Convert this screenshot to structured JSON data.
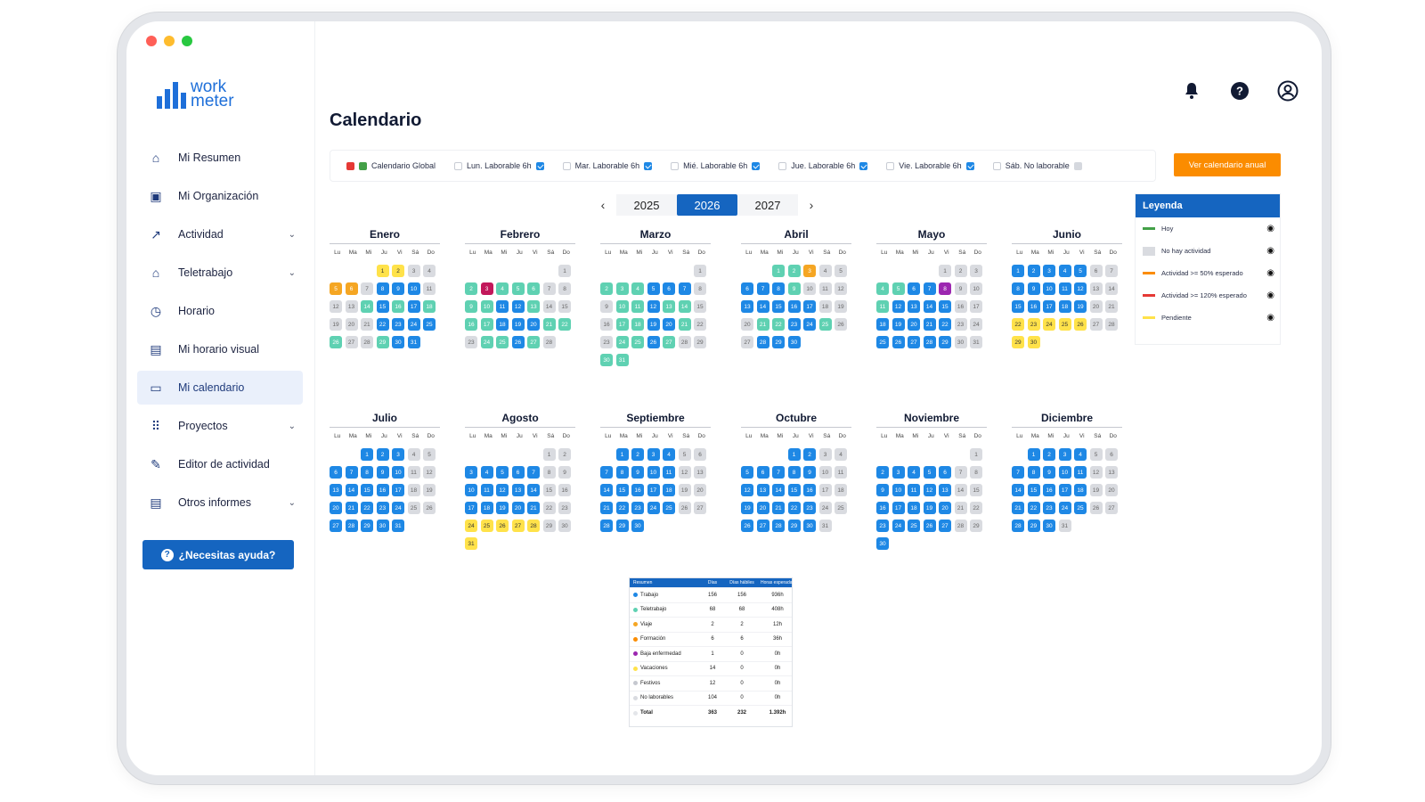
{
  "window": {
    "dot_colors": [
      "#ff5f57",
      "#febc2e",
      "#28c840"
    ]
  },
  "brand": {
    "line1": "work",
    "line2": "meter"
  },
  "sidebar": {
    "items": [
      {
        "label": "Mi Resumen",
        "icon": "home-icon",
        "chevron": false,
        "active": false
      },
      {
        "label": "Mi Organización",
        "icon": "calendar-org-icon",
        "chevron": false,
        "active": false
      },
      {
        "label": "Actividad",
        "icon": "trend-icon",
        "chevron": true,
        "active": false
      },
      {
        "label": "Teletrabajo",
        "icon": "house-work-icon",
        "chevron": true,
        "active": false
      },
      {
        "label": "Horario",
        "icon": "clock-icon",
        "chevron": false,
        "active": false
      },
      {
        "label": "Mi horario visual",
        "icon": "visual-schedule-icon",
        "chevron": false,
        "active": false
      },
      {
        "label": "Mi calendario",
        "icon": "calendar-icon",
        "chevron": false,
        "active": true
      },
      {
        "label": "Proyectos",
        "icon": "grid-icon",
        "chevron": true,
        "active": false
      },
      {
        "label": "Editor de actividad",
        "icon": "pencil-icon",
        "chevron": false,
        "active": false
      },
      {
        "label": "Otros informes",
        "icon": "document-icon",
        "chevron": true,
        "active": false
      }
    ],
    "help_label": "¿Necesitas ayuda?"
  },
  "header": {
    "title": "Calendario"
  },
  "filters": [
    {
      "label": "Calendario Global",
      "state": "global"
    },
    {
      "label": "Lun. Laborable 6h",
      "state": "on"
    },
    {
      "label": "Mar. Laborable 6h",
      "state": "on"
    },
    {
      "label": "Mié. Laborable 6h",
      "state": "on"
    },
    {
      "label": "Jue. Laborable 6h",
      "state": "on"
    },
    {
      "label": "Vie. Laborable 6h",
      "state": "on"
    },
    {
      "label": "Sáb. No laborable",
      "state": "grey"
    }
  ],
  "annual_button": "Ver calendario anual",
  "years": {
    "prev_icon": "‹",
    "next_icon": "›",
    "list": [
      "2025",
      "2026",
      "2027"
    ],
    "selected": "2026"
  },
  "weekdays": [
    "Lu",
    "Ma",
    "Mi",
    "Ju",
    "Vi",
    "Sá",
    "Do"
  ],
  "months": [
    {
      "name": "Enero",
      "offset": 3,
      "days": 31,
      "codes": "ffnnoonwwwnnntwtwtnnnwwwwtnntwwtn"
    },
    {
      "name": "Febrero",
      "offset": 6,
      "days": 28,
      "codes": "ntptttnnttwwtnnttwwwttnttwtnn"
    },
    {
      "name": "Marzo",
      "offset": 6,
      "days": 31,
      "codes": "ntttwwwnnttwttnnttwwtnnttwtnntt"
    },
    {
      "name": "Abril",
      "offset": 2,
      "days": 30,
      "codes": "ttonnwwwtnnnwwwwwnnnttwwtnnwwwww"
    },
    {
      "name": "Mayo",
      "offset": 4,
      "days": 31,
      "codes": "nnnttwwvnntwwwwnnwwwwwnnwwwwwnn"
    },
    {
      "name": "Junio",
      "offset": 0,
      "days": 30,
      "codes": "wwwwwnnwwwwwnnwwwwwnnfffffnnff"
    },
    {
      "name": "Julio",
      "offset": 2,
      "days": 31,
      "codes": "wwwnnwwwwwnnwwwwwnnwwwwwnnwwwww"
    },
    {
      "name": "Agosto",
      "offset": 5,
      "days": 31,
      "codes": "nnwwwwwnnwwwwwnnwwwwwnnfffffnnf"
    },
    {
      "name": "Septiembre",
      "offset": 1,
      "days": 30,
      "codes": "wwwwnnwwwwwnnwwwwwnnwwwwwnnwww"
    },
    {
      "name": "Octubre",
      "offset": 3,
      "days": 31,
      "codes": "wwnnwwwwwnnwwwwwnnwwwwwnnwwwwwn"
    },
    {
      "name": "Noviembre",
      "offset": 6,
      "days": 30,
      "codes": "nwwwwwnnwwwwwnnwwwwwnnwwwwwnnw"
    },
    {
      "name": "Diciembre",
      "offset": 1,
      "days": 31,
      "codes": "wwwwnnwwwwwnnwwwwwnnwwwwwnnwww"
    }
  ],
  "day_colors": {
    "w": "#1e88e5",
    "t": "#5fd1b2",
    "o": "#f5a623",
    "f": "#ffe24a",
    "p": "#c2185b",
    "v": "#9c27b0",
    "n": "#d9dbe0"
  },
  "legend": {
    "title": "Leyenda",
    "items": [
      {
        "label": "Hoy",
        "color": "#43a047",
        "icon": "eye-icon"
      },
      {
        "label": "No hay actividad",
        "color": "#d9dbe0",
        "icon": "eye-icon"
      },
      {
        "label": "Actividad >= 50% esperado",
        "color": "#fb8c00",
        "icon": "eye-icon"
      },
      {
        "label": "Actividad >= 120% esperado",
        "color": "#e53935",
        "icon": "eye-icon"
      },
      {
        "label": "Pendiente",
        "color": "#ffe24a",
        "icon": "eye-icon"
      }
    ]
  },
  "summary": {
    "headers": [
      "Resumen",
      "Días",
      "Días hábiles",
      "Horas esperadas"
    ],
    "rows": [
      {
        "label": "Trabajo",
        "color": "#1e88e5",
        "dias": "156",
        "habiles": "156",
        "horas": "936h"
      },
      {
        "label": "Teletrabajo",
        "color": "#5fd1b2",
        "dias": "68",
        "habiles": "68",
        "horas": "408h"
      },
      {
        "label": "Viaje",
        "color": "#f5a623",
        "dias": "2",
        "habiles": "2",
        "horas": "12h"
      },
      {
        "label": "Formación",
        "color": "#fb8c00",
        "dias": "6",
        "habiles": "6",
        "horas": "36h"
      },
      {
        "label": "Baja enfermedad",
        "color": "#9c27b0",
        "dias": "1",
        "habiles": "0",
        "horas": "0h"
      },
      {
        "label": "Vacaciones",
        "color": "#ffe24a",
        "dias": "14",
        "habiles": "0",
        "horas": "0h"
      },
      {
        "label": "Festivos",
        "color": "#c5c8cf",
        "dias": "12",
        "habiles": "0",
        "horas": "0h"
      },
      {
        "label": "No laborables",
        "color": "#d9dbe0",
        "dias": "104",
        "habiles": "0",
        "horas": "0h"
      },
      {
        "label": "Total",
        "color": "#e4e6ea",
        "dias": "363",
        "habiles": "232",
        "horas": "1.392h"
      }
    ]
  }
}
